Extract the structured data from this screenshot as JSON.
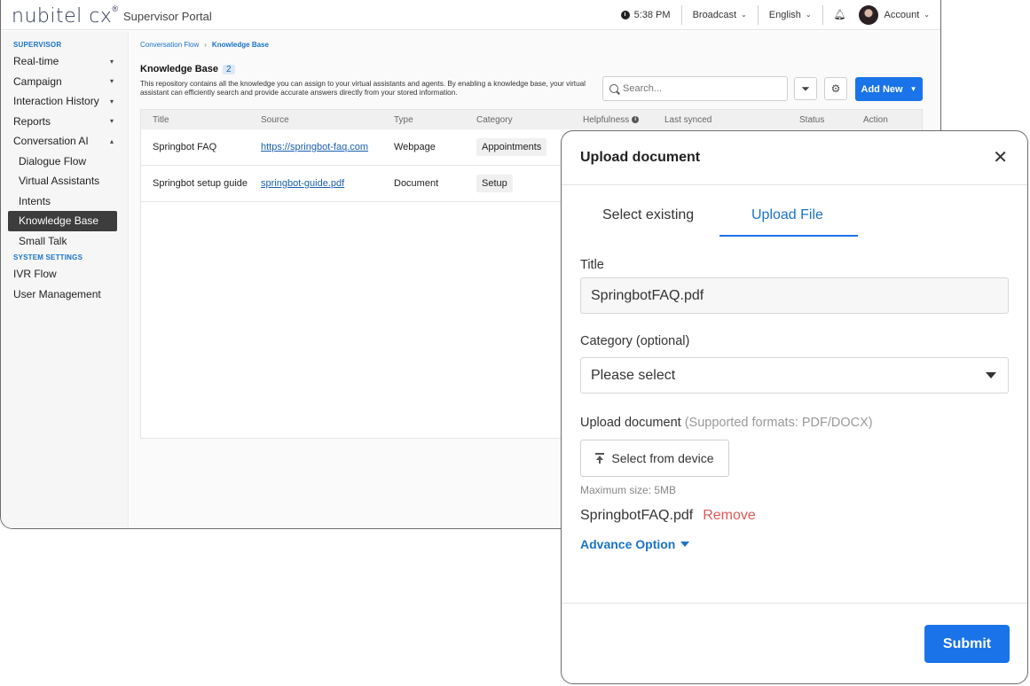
{
  "header": {
    "logo_text": "nubitel cx",
    "logo_sup": "®",
    "portal_name": "Supervisor Portal",
    "time": "5:38 PM",
    "broadcast_label": "Broadcast",
    "language_label": "English",
    "account_label": "Account"
  },
  "sidebar": {
    "section_supervisor": "SUPERVISOR",
    "items": [
      {
        "label": "Real-time",
        "caret": "▾"
      },
      {
        "label": "Campaign",
        "caret": "▾"
      },
      {
        "label": "Interaction History",
        "caret": "▾"
      },
      {
        "label": "Reports",
        "caret": "▾"
      },
      {
        "label": "Conversation AI",
        "caret": "▴"
      }
    ],
    "sub_items": [
      {
        "label": "Dialogue Flow"
      },
      {
        "label": "Virtual Assistants"
      },
      {
        "label": "Intents"
      },
      {
        "label": "Knowledge Base",
        "active": true
      },
      {
        "label": "Small Talk"
      }
    ],
    "section_system": "SYSTEM SETTINGS",
    "system_items": [
      {
        "label": "IVR Flow"
      },
      {
        "label": "User Management"
      }
    ]
  },
  "main": {
    "breadcrumb": {
      "parent": "Conversation Flow",
      "separator": "›",
      "current": "Knowledge Base"
    },
    "title": "Knowledge Base",
    "count": "2",
    "description": "This repository contains all the knowledge you can assign to your virtual assistants and agents. By enabling a knowledge base, your virtual assistant can efficiently search and provide accurate answers directly from your stored information.",
    "search": {
      "placeholder": "Search..."
    },
    "add_new_label": "Add New",
    "table": {
      "columns": [
        "Title",
        "Source",
        "Type",
        "Category",
        "Helpfulness",
        "Last synced",
        "Status",
        "Action"
      ],
      "rows": [
        {
          "title": "Springbot FAQ",
          "source": "https://springbot-faq.com",
          "type": "Webpage",
          "category": "Appointments"
        },
        {
          "title": "Springbot setup guide",
          "source": "springbot-guide.pdf",
          "type": "Document",
          "category": "Setup"
        }
      ]
    }
  },
  "modal": {
    "title": "Upload document",
    "close": "✕",
    "tabs": [
      {
        "label": "Select existing",
        "active": false
      },
      {
        "label": "Upload File",
        "active": true
      }
    ],
    "title_label": "Title",
    "title_value": "SpringbotFAQ.pdf",
    "category_label": "Category (optional)",
    "category_value": "Please select",
    "upload_label": "Upload document",
    "upload_hint": "(Supported formats: PDF/DOCX)",
    "device_button": "Select from device",
    "max_size": "Maximum size: 5MB",
    "file_name": "SpringbotFAQ.pdf",
    "remove_label": "Remove",
    "advance_label": "Advance Option",
    "submit_label": "Submit"
  },
  "colors": {
    "accent": "#1a73e8",
    "remove": "#e05858",
    "active_nav": "#3d3d3d"
  }
}
